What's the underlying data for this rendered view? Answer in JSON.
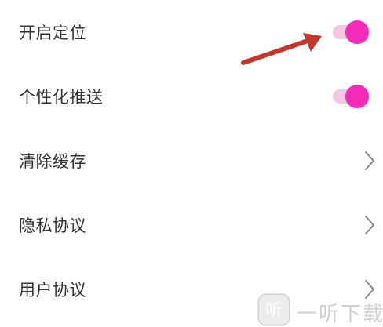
{
  "settings": {
    "items": [
      {
        "label": "开启定位",
        "control": "toggle",
        "on": true
      },
      {
        "label": "个性化推送",
        "control": "toggle",
        "on": true
      },
      {
        "label": "清除缓存",
        "control": "chevron"
      },
      {
        "label": "隐私协议",
        "control": "chevron"
      },
      {
        "label": "用户协议",
        "control": "chevron"
      }
    ]
  },
  "watermark": {
    "logo_glyph": "听",
    "text": "一听下载"
  },
  "colors": {
    "toggle_thumb": "#f22bb8",
    "toggle_track": "#f5c7e4",
    "annotation_arrow": "#c0392b",
    "label_text": "#333333",
    "chevron": "#888888"
  }
}
